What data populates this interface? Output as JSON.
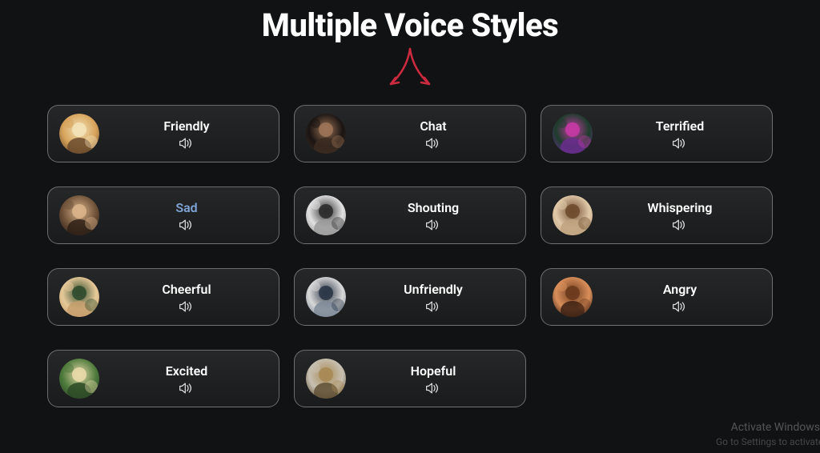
{
  "title": "Multiple Voice Styles",
  "accent_color": "#cc2a3f",
  "highlight_color": "#7fa3d6",
  "voices": [
    {
      "name": "friendly",
      "label": "Friendly",
      "highlighted": false,
      "avatar_palette": [
        "#d6a25a",
        "#f3e2b8",
        "#6a4a2d"
      ]
    },
    {
      "name": "chat",
      "label": "Chat",
      "highlighted": false,
      "avatar_palette": [
        "#1a1412",
        "#9c7356",
        "#3c2c22"
      ]
    },
    {
      "name": "terrified",
      "label": "Terrified",
      "highlighted": false,
      "avatar_palette": [
        "#1c3d2b",
        "#c43aa4",
        "#6a2d8f"
      ]
    },
    {
      "name": "sad",
      "label": "Sad",
      "highlighted": true,
      "avatar_palette": [
        "#6e5138",
        "#d9b38a",
        "#2e2016"
      ]
    },
    {
      "name": "shouting",
      "label": "Shouting",
      "highlighted": false,
      "avatar_palette": [
        "#e1e1e1",
        "#2c2c2c",
        "#9a9a9a"
      ]
    },
    {
      "name": "whispering",
      "label": "Whispering",
      "highlighted": false,
      "avatar_palette": [
        "#e0c9a8",
        "#6e4b2e",
        "#bfa380"
      ]
    },
    {
      "name": "cheerful",
      "label": "Cheerful",
      "highlighted": false,
      "avatar_palette": [
        "#e6c898",
        "#304d2e",
        "#c79f6d"
      ]
    },
    {
      "name": "unfriendly",
      "label": "Unfriendly",
      "highlighted": false,
      "avatar_palette": [
        "#d8d8d8",
        "#2b3647",
        "#7e8a99"
      ]
    },
    {
      "name": "angry",
      "label": "Angry",
      "highlighted": false,
      "avatar_palette": [
        "#d98f5a",
        "#6c3a1d",
        "#3b2013"
      ]
    },
    {
      "name": "excited",
      "label": "Excited",
      "highlighted": false,
      "avatar_palette": [
        "#4d7a3c",
        "#e8d9a9",
        "#2d4a26"
      ]
    },
    {
      "name": "hopeful",
      "label": "Hopeful",
      "highlighted": false,
      "avatar_palette": [
        "#c7c0b2",
        "#a88a55",
        "#5e4e32"
      ]
    }
  ],
  "watermark": {
    "line1": "Activate Windows",
    "line2": "Go to Settings to activate Windows."
  }
}
